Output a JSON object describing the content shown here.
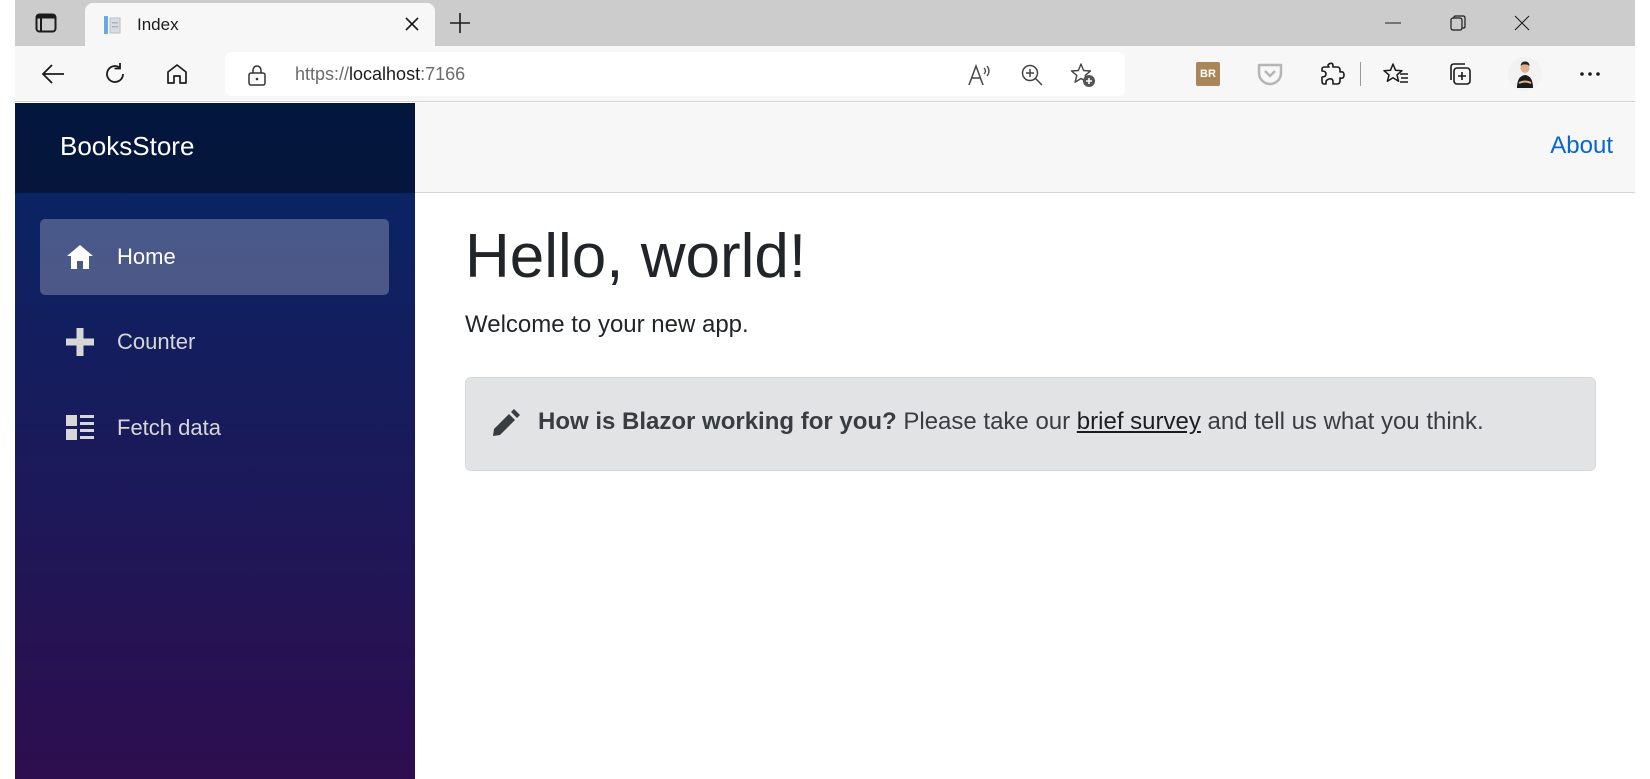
{
  "browser": {
    "tab": {
      "title": "Index"
    },
    "address": {
      "scheme": "https://",
      "host": "localhost",
      "port": ":7166"
    },
    "toolbar_icons": [
      "back-icon",
      "refresh-icon",
      "home-icon",
      "lock-icon",
      "read-aloud-icon",
      "zoom-icon",
      "add-favorite-icon",
      "extension-br-icon",
      "pocket-icon",
      "extensions-icon",
      "favorites-icon",
      "collections-icon",
      "profile-avatar",
      "more-icon"
    ],
    "extension_br": {
      "label": "BR",
      "color": "#a9865a"
    }
  },
  "app": {
    "brand": "BooksStore",
    "nav": [
      {
        "label": "Home",
        "icon": "home-icon",
        "active": true
      },
      {
        "label": "Counter",
        "icon": "plus-icon",
        "active": false
      },
      {
        "label": "Fetch data",
        "icon": "list-icon",
        "active": false
      }
    ],
    "top_link": "About",
    "colors": {
      "link": "#0366d6",
      "sidebar_top": "#052767",
      "sidebar_bottom": "#3a0647",
      "alert_bg": "#e2e3e5"
    }
  },
  "main": {
    "heading": "Hello, world!",
    "welcome": "Welcome to your new app.",
    "survey": {
      "question": "How is Blazor working for you?",
      "before_link": " Please take our ",
      "link_text": "brief survey",
      "after_link": " and tell us what you think."
    }
  }
}
